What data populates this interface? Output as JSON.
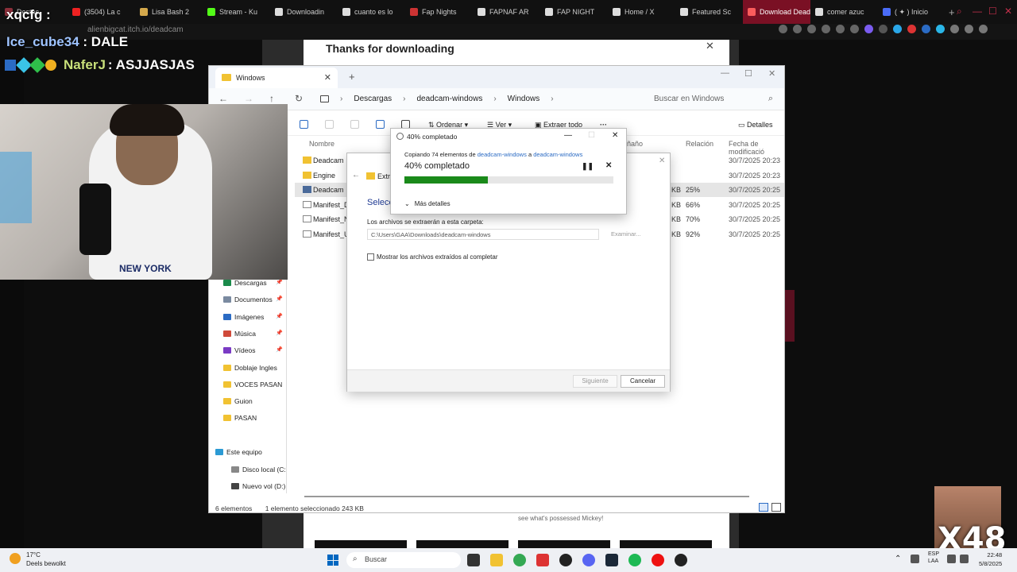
{
  "browser": {
    "tabs": [
      {
        "label": "Destac",
        "color": "#8b2f3a",
        "active": false
      },
      {
        "label": "(3504) La c",
        "color": "#e22",
        "active": false
      },
      {
        "label": "Lisa Bash 2",
        "color": "#d4a84b",
        "active": false
      },
      {
        "label": "Stream - Ku",
        "color": "#53fc18",
        "active": false
      },
      {
        "label": "Downloadin",
        "color": "#ddd",
        "active": false
      },
      {
        "label": "cuanto es lo",
        "color": "#ddd",
        "active": false
      },
      {
        "label": "Fap Nights",
        "color": "#c33",
        "active": false
      },
      {
        "label": "FAPNAF AR",
        "color": "#ddd",
        "active": false
      },
      {
        "label": "FAP NIGHT",
        "color": "#ddd",
        "active": false
      },
      {
        "label": "Home / X",
        "color": "#ddd",
        "active": false
      },
      {
        "label": "Featured Sc",
        "color": "#ddd",
        "active": false
      },
      {
        "label": "Download Deadcam (",
        "color": "#fa5c5c",
        "active": true
      },
      {
        "label": "comer azuc",
        "color": "#ddd",
        "active": false
      },
      {
        "label": "( ✦ ) Inicio",
        "color": "#4a6cf7",
        "active": false
      }
    ],
    "url": "alienbigcat.itch.io/deadcam"
  },
  "site": {
    "dialog_title": "Thanks for downloading",
    "caption": "see what's possessed Mickey!"
  },
  "explorer": {
    "tab_label": "Windows",
    "breadcrumbs": [
      "Descargas",
      "deadcam-windows",
      "Windows"
    ],
    "search_placeholder": "Buscar en Windows",
    "commands": {
      "sort": "Ordenar",
      "view": "Ver",
      "extract": "Extraer todo",
      "more": "···",
      "details": "Detalles"
    },
    "columns": {
      "name": "Nombre",
      "size": "ñaño",
      "ratio": "Relación",
      "date": "Fecha de modificació"
    },
    "files": [
      {
        "name": "Deadcam",
        "size": "",
        "ratio": "",
        "date": "30/7/2025 20:23",
        "type": "folder",
        "selected": false
      },
      {
        "name": "Engine",
        "size": "",
        "ratio": "",
        "date": "30/7/2025 20:23",
        "type": "folder",
        "selected": false
      },
      {
        "name": "Deadcam",
        "size": "KB",
        "ratio": "25%",
        "date": "30/7/2025 20:25",
        "type": "app",
        "selected": true
      },
      {
        "name": "Manifest_De",
        "size": "KB",
        "ratio": "66%",
        "date": "30/7/2025 20:25",
        "type": "file",
        "selected": false
      },
      {
        "name": "Manifest_Nc",
        "size": "KB",
        "ratio": "70%",
        "date": "30/7/2025 20:25",
        "type": "file",
        "selected": false
      },
      {
        "name": "Manifest_UF",
        "size": "KB",
        "ratio": "92%",
        "date": "30/7/2025 20:25",
        "type": "file",
        "selected": false
      }
    ],
    "nav": [
      {
        "label": "Descargas",
        "pinned": true,
        "color": "#1a8a4a"
      },
      {
        "label": "Documentos",
        "pinned": true,
        "color": "#7a8aa0"
      },
      {
        "label": "Imágenes",
        "pinned": true,
        "color": "#2b6bc4"
      },
      {
        "label": "Música",
        "pinned": true,
        "color": "#d04a3a"
      },
      {
        "label": "Vídeos",
        "pinned": true,
        "color": "#7a3ac4"
      },
      {
        "label": "Doblaje Ingles",
        "pinned": false,
        "color": "#f1c232"
      },
      {
        "label": "VOCES PASAN",
        "pinned": false,
        "color": "#f1c232"
      },
      {
        "label": "Guion",
        "pinned": false,
        "color": "#f1c232"
      },
      {
        "label": "PASAN",
        "pinned": false,
        "color": "#f1c232"
      },
      {
        "label": "Este equipo",
        "pinned": false,
        "color": "#2b9ad4"
      },
      {
        "label": "Disco local (C:",
        "pinned": false,
        "color": "#888"
      },
      {
        "label": "Nuevo vol (D:)",
        "pinned": false,
        "color": "#444"
      }
    ],
    "status_count": "6 elementos",
    "status_selected": "1 elemento seleccionado  243 KB"
  },
  "wizard": {
    "title": "Extra",
    "heading": "Selecc",
    "dest_label": "Los archivos se extraerán a esta carpeta:",
    "dest_path": "C:\\Users\\GAA\\Downloads\\deadcam-windows",
    "browse": "Examinar...",
    "show_files": "Mostrar los archivos extraídos al completar",
    "next": "Siguiente",
    "cancel": "Cancelar"
  },
  "progress": {
    "title": "40% completado",
    "desc_prefix": "Copiando 74 elementos de ",
    "src": "deadcam-windows",
    "desc_mid": " a ",
    "dst": "deadcam-windows",
    "percent_label": "40% completado",
    "percent": 40,
    "more_details": "Más detalles"
  },
  "overlay": {
    "chat1": "xqcfg :",
    "chat2_user": "Ice_cube34",
    "chat2_msg": ": DALE",
    "chat3_user": "NaferJ",
    "chat3_msg": ": ASJJASJAS",
    "shirt_text": "NEW YORK",
    "multiplier": "X48"
  },
  "taskbar": {
    "weather_temp": "17°C",
    "weather_desc": "Deels bewolkt",
    "search": "Buscar",
    "lang_top": "ESP",
    "lang_bottom": "LAA",
    "time": "22:48",
    "date": "5/8/2025"
  }
}
